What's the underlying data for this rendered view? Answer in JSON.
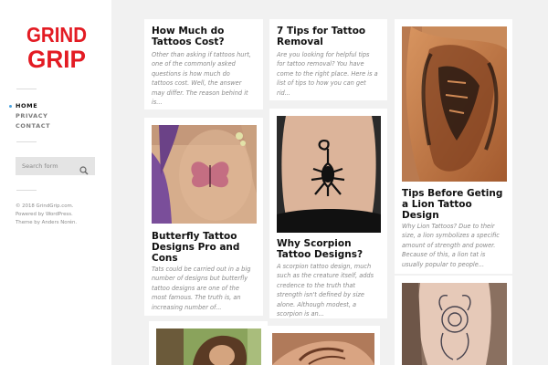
{
  "site": {
    "logo_line1": "GRIND",
    "logo_line2": "GRIP",
    "brand_color": "#e31b23"
  },
  "nav": {
    "items": [
      {
        "label": "HOME",
        "active": true
      },
      {
        "label": "PRIVACY",
        "active": false
      },
      {
        "label": "CONTACT",
        "active": false
      }
    ]
  },
  "search": {
    "placeholder": "Search form",
    "icon": "search-icon"
  },
  "footer": {
    "lines": [
      "© 2018 GrindGrip.com.",
      "Powered by WordPress.",
      "Theme by Anders Norén."
    ]
  },
  "posts": [
    {
      "title_lines": [
        "How Much do",
        "Tattoos Cost?"
      ],
      "excerpt_lines": [
        "Other than asking if tattoos hurt,",
        "one of the commonly asked",
        "questions is how much do",
        "tattoos cost. Well, the answer",
        "may differ. The reason behind it",
        "is..."
      ]
    },
    {
      "title_lines": [
        "7 Tips for Tattoo",
        "Removal"
      ],
      "excerpt_lines": [
        "Are you looking for helpful tips",
        "for tattoo removal? You have",
        "come to the right place. Here is a",
        "list of tips to how you can get",
        "rid..."
      ]
    },
    {
      "title_lines": [
        "Tips Before Geting",
        "a Lion Tattoo",
        "Design"
      ],
      "excerpt_lines": [
        "Why Lion Tattoos? Due to their",
        "size, a lion symbolizes a specific",
        "amount of strength and power.",
        "Because of this, a lion tat is",
        "usually popular to people..."
      ]
    },
    {
      "title_lines": [
        "Butterfly Tattoo",
        "Designs Pro and",
        "Cons"
      ],
      "excerpt_lines": [
        "Tats could be carried out in a big",
        "number of designs but butterfly",
        "tattoo designs are one of the",
        "most famous. The truth is, an",
        "increasing number of..."
      ]
    },
    {
      "title_lines": [
        "Why Scorpion",
        "Tattoo Designs?"
      ],
      "excerpt_lines": [
        "A scorpion tattoo design, much",
        "such as the creature itself, adds",
        "credence to the truth that",
        "strength isn't defined by size",
        "alone. Although modest, a",
        "scorpion is an..."
      ]
    }
  ]
}
